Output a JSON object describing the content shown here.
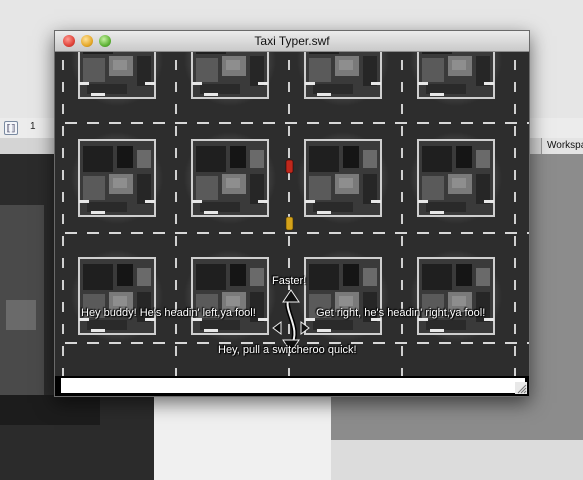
{
  "window": {
    "title": "Taxi Typer.swf",
    "controls": {
      "close": "close-button",
      "minimize": "minimize-button",
      "zoom": "zoom-button"
    }
  },
  "game": {
    "captions": {
      "faster": "Faster!",
      "left": "Hey buddy! He's headin' left,ya fool!",
      "right": "Get right, he's headin' right,ya fool!",
      "switcheroo": "Hey, pull a switcheroo quick!"
    },
    "cars": [
      {
        "name": "red-car",
        "color": "#c0281c"
      },
      {
        "name": "taxi-car",
        "color": "#d4a21a"
      }
    ],
    "typing_input": {
      "value": "",
      "placeholder": ""
    }
  },
  "background_app": {
    "toolbar_number": "1",
    "workspace_tab": "Workspa"
  }
}
